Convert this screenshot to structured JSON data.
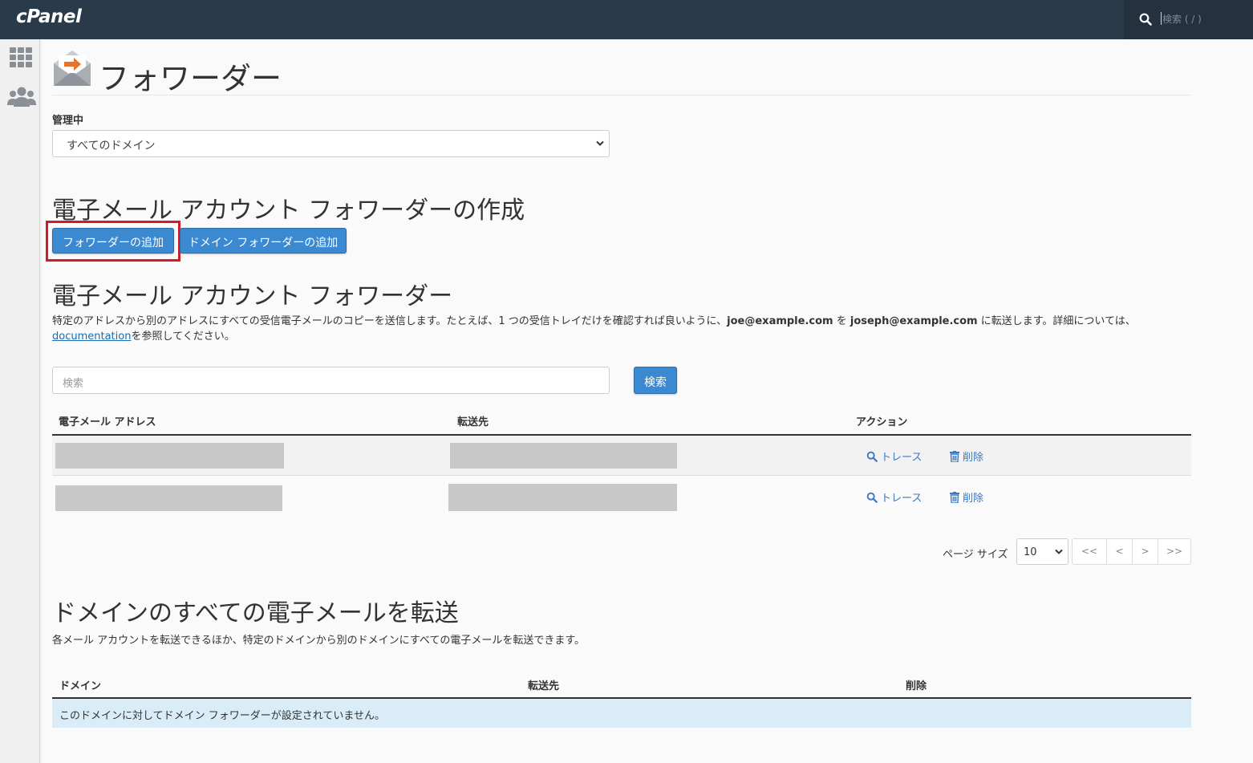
{
  "topbar": {
    "logo": "cPanel",
    "search_placeholder": "検索 ( / )"
  },
  "sidebar": {
    "icons": [
      "apps-grid-icon",
      "users-icon"
    ]
  },
  "page": {
    "title": "フォワーダー",
    "icon": "forwarder-envelope-icon"
  },
  "managing": {
    "label": "管理中",
    "selected": "すべてのドメイン"
  },
  "create": {
    "heading": "電子メール アカウント フォワーダーの作成",
    "add_button": "フォワーダーの追加",
    "add_domain_button": "ドメイン フォワーダーの追加"
  },
  "forwarders": {
    "heading": "電子メール アカウント フォワーダー",
    "desc_part1": "特定のアドレスから別のアドレスにすべての受信電子メールのコピーを送信します。たとえば、1 つの受信トレイだけを確認すれば良いように、",
    "desc_email1": "joe@example.com",
    "desc_part2": " を ",
    "desc_email2": "joseph@example.com",
    "desc_part3": " に転送します。詳細については、",
    "desc_link": "documentation",
    "desc_part4": "を参照してください。",
    "search_placeholder": "検索",
    "search_button": "検索",
    "columns": {
      "address": "電子メール アドレス",
      "forward_to": "転送先",
      "actions": "アクション"
    },
    "rows": [
      {
        "trace": "トレース",
        "delete": "削除"
      },
      {
        "trace": "トレース",
        "delete": "削除"
      }
    ],
    "pagination": {
      "page_size_label": "ページ サイズ",
      "page_size": "10",
      "first": "<<",
      "prev": "<",
      "next": ">",
      "last": ">>"
    }
  },
  "domain_forward": {
    "heading": "ドメインのすべての電子メールを転送",
    "desc": "各メール アカウントを転送できるほか、特定のドメインから別のドメインにすべての電子メールを転送できます。",
    "columns": {
      "domain": "ドメイン",
      "forward_to": "転送先",
      "delete": "削除"
    },
    "empty_message": "このドメインに対してドメイン フォワーダーが設定されていません。"
  },
  "colors": {
    "topbar": "#293a4a",
    "primary_button": "#3b8ad1",
    "link": "#3b7ac0",
    "highlight": "#d7182a",
    "info_row": "#d9ecf7"
  }
}
